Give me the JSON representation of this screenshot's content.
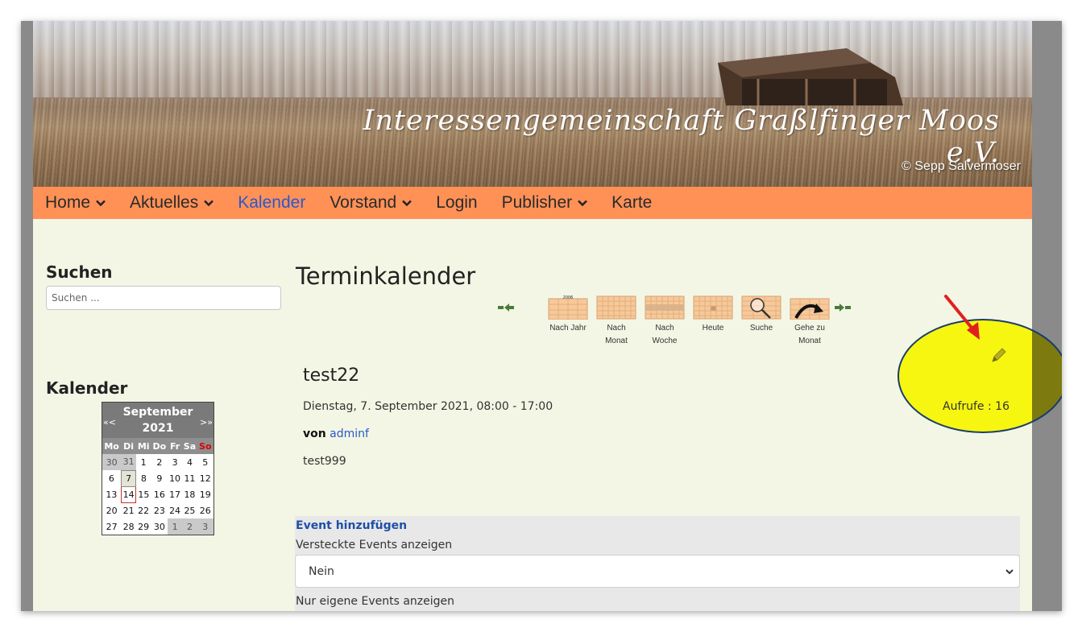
{
  "banner": {
    "title": "Interessengemeinschaft Graßlfinger Moos e.V.",
    "credit": "© Sepp Salvermoser"
  },
  "nav": {
    "items": [
      {
        "label": "Home",
        "has_menu": true
      },
      {
        "label": "Aktuelles",
        "has_menu": true
      },
      {
        "label": "Kalender",
        "has_menu": false,
        "active": true
      },
      {
        "label": "Vorstand",
        "has_menu": true
      },
      {
        "label": "Login",
        "has_menu": false
      },
      {
        "label": "Publisher",
        "has_menu": true
      },
      {
        "label": "Karte",
        "has_menu": false
      }
    ]
  },
  "sidebar": {
    "search_heading": "Suchen",
    "search_placeholder": "Suchen ...",
    "calendar_heading": "Kalender",
    "mini_calendar": {
      "month": "September",
      "year": "2021",
      "prev": "«<",
      "next": ">»",
      "weekdays": [
        "Mo",
        "Di",
        "Mi",
        "Do",
        "Fr",
        "Sa",
        "So"
      ],
      "weeks": [
        [
          "30",
          "31",
          "1",
          "2",
          "3",
          "4",
          "5"
        ],
        [
          "6",
          "7",
          "8",
          "9",
          "10",
          "11",
          "12"
        ],
        [
          "13",
          "14",
          "15",
          "16",
          "17",
          "18",
          "19"
        ],
        [
          "20",
          "21",
          "22",
          "23",
          "24",
          "25",
          "26"
        ],
        [
          "27",
          "28",
          "29",
          "30",
          "1",
          "2",
          "3"
        ]
      ],
      "selected_day": "7",
      "today": "14"
    }
  },
  "main": {
    "title": "Terminkalender",
    "toolbar": {
      "year_label": "Nach Jahr",
      "year_icon_text": "2006",
      "month_label_1": "Nach",
      "month_label_2": "Monat",
      "week_label_1": "Nach",
      "week_label_2": "Woche",
      "today_label": "Heute",
      "search_label": "Suche",
      "goto_label_1": "Gehe zu",
      "goto_label_2": "Monat"
    },
    "event": {
      "title": "test22",
      "date": "Dienstag, 7. September 2021, 08:00 - 17:00",
      "by_label": "von",
      "author": "adminf",
      "description": "test999",
      "views": "Aufrufe : 16"
    },
    "filters": {
      "add_event": "Event hinzufügen",
      "hidden_label": "Versteckte Events anzeigen",
      "hidden_value": "Nein",
      "own_label": "Nur eigene Events anzeigen"
    }
  },
  "colors": {
    "nav_bg": "#ff9157",
    "page_bg": "#f3f6e4",
    "link": "#2b58c9",
    "highlight": "#f5f500",
    "arrow": "#e02020"
  }
}
